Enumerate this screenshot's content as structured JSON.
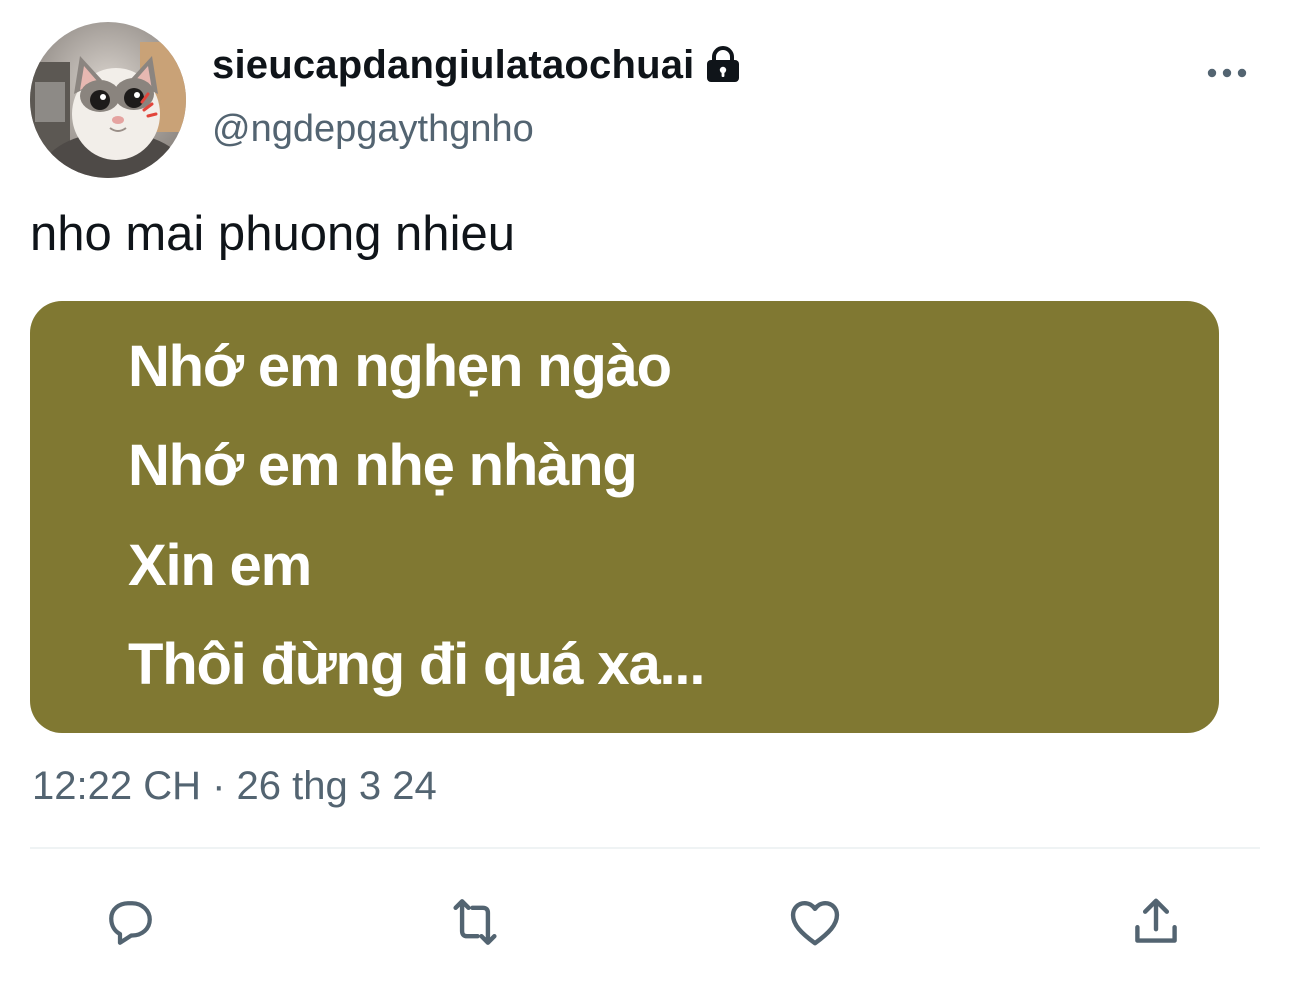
{
  "tweet": {
    "author": {
      "display_name": "sieucapdangiulataochuai",
      "handle": "@ngdepgaythgnho",
      "avatar_icon": "cat-avatar",
      "protected_icon": "lock-icon"
    },
    "text": "nho mai phuong nhieu",
    "lyrics_card": {
      "background": "#807832",
      "lines": [
        "Nhớ em nghẹn ngào",
        "Nhớ em nhẹ nhàng",
        "Xin em",
        "Thôi đừng đi quá xa..."
      ]
    },
    "timestamp": "12:22 CH · 26 thg 3 24"
  },
  "actions": [
    {
      "name": "reply",
      "icon": "reply-icon"
    },
    {
      "name": "retweet",
      "icon": "retweet-icon"
    },
    {
      "name": "like",
      "icon": "heart-icon"
    },
    {
      "name": "share",
      "icon": "share-icon"
    }
  ],
  "more_icon": "more-dots-icon",
  "colors": {
    "text_primary": "#0f1419",
    "text_secondary": "#536471",
    "icon": "#536471",
    "divider": "#eff3f4"
  }
}
